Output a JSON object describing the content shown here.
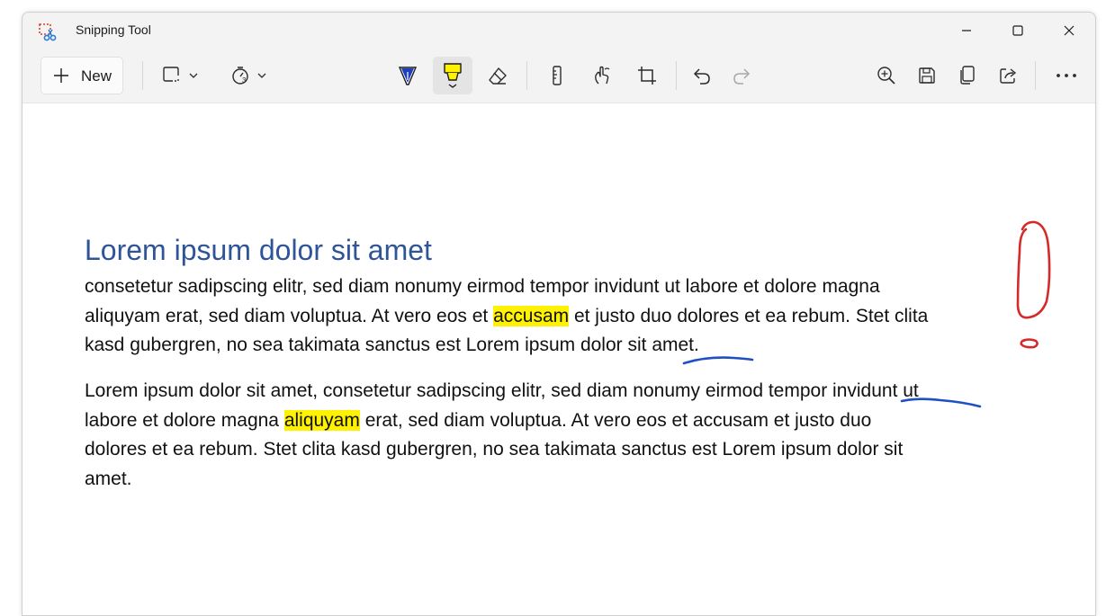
{
  "window": {
    "title": "Snipping Tool",
    "controls": {
      "minimize": "minimize-icon",
      "maximize": "maximize-icon",
      "close": "close-icon"
    }
  },
  "toolbar": {
    "new_label": "New",
    "icons": {
      "snip_mode": "rectangle-snip-icon",
      "delay": "timer-icon",
      "pen": "ballpoint-pen-icon",
      "highlighter": "highlighter-icon",
      "eraser": "eraser-icon",
      "ruler": "ruler-icon",
      "touch_writing": "touch-writing-icon",
      "crop": "crop-icon",
      "undo": "undo-icon",
      "redo": "redo-icon",
      "zoom": "zoom-in-icon",
      "save": "save-icon",
      "copy": "copy-icon",
      "share": "share-icon",
      "more": "more-icon"
    },
    "active_tool": "highlighter"
  },
  "document": {
    "heading": "Lorem ipsum dolor sit amet",
    "para1": {
      "l1": "consetetur sadipscing elitr, sed diam nonumy eirmod tempor invidunt ut labore et dolore magna",
      "l2a": "aliquyam erat, sed diam voluptua. At vero eos et ",
      "l2b": "accusam",
      "l2c": " et justo duo dolores et ea rebum. Stet clita",
      "l3": "kasd gubergren, no sea takimata sanctus est Lorem ipsum dolor sit amet."
    },
    "para2": {
      "l1": "Lorem ipsum dolor sit amet, consetetur sadipscing elitr, sed diam nonumy eirmod tempor invidunt ut",
      "l2a": "labore et dolore magna ",
      "l2b": "aliquyam",
      "l2c": " erat, sed diam voluptua. At vero eos et accusam et justo duo",
      "l3": "dolores et ea rebum. Stet clita kasd gubergren, no sea takimata sanctus est Lorem ipsum dolor sit",
      "l4": "amet."
    }
  },
  "colors": {
    "heading": "#2f5597",
    "highlight": "#fff200",
    "blue_ink": "#1f4fc4",
    "red_ink": "#d42a2a",
    "active_tool_bg": "#e4e4e4"
  }
}
